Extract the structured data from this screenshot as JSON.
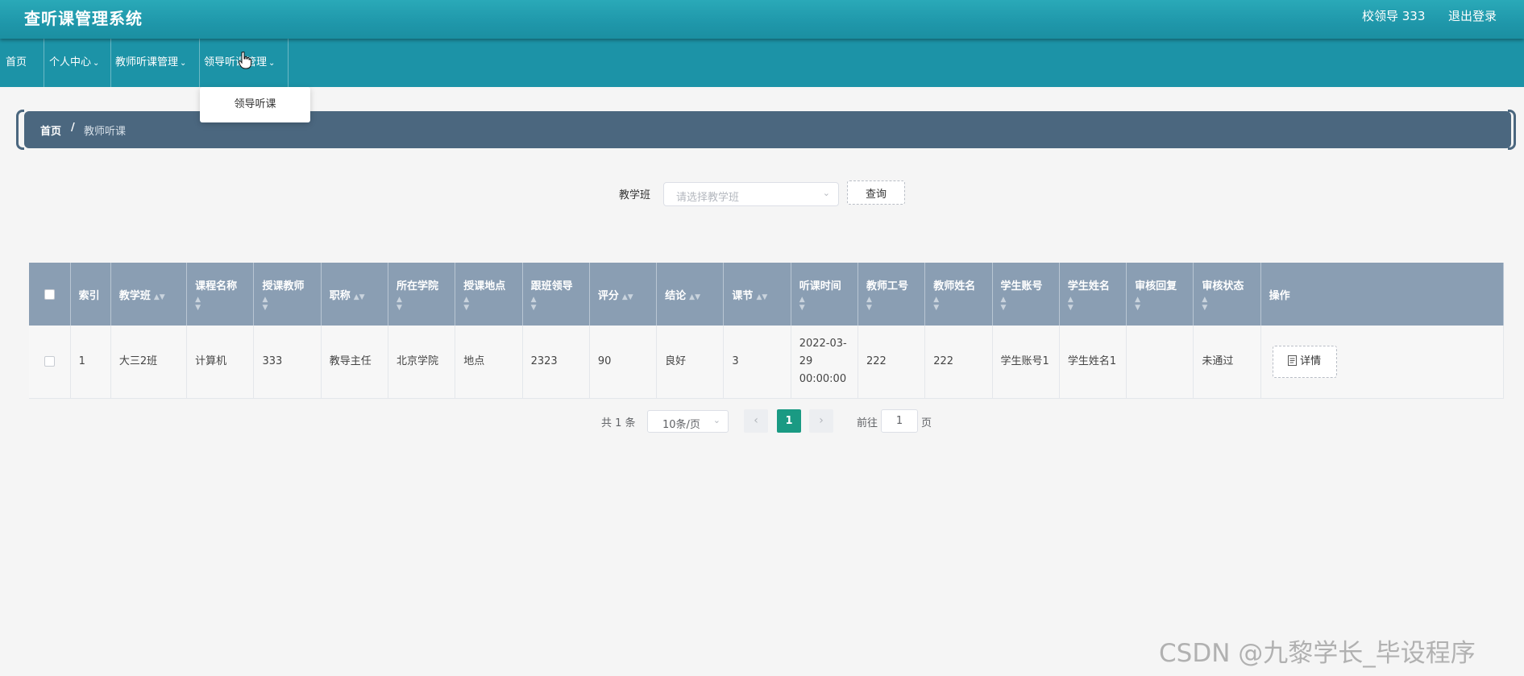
{
  "header": {
    "app_title": "查听课管理系统",
    "user_name": "校领导 333",
    "logout_label": "退出登录"
  },
  "nav": {
    "items": [
      {
        "label": "首页",
        "has_dropdown": false
      },
      {
        "label": "个人中心",
        "has_dropdown": true
      },
      {
        "label": "教师听课管理",
        "has_dropdown": true
      },
      {
        "label": "领导听课管理",
        "has_dropdown": true
      }
    ],
    "open_dropdown": {
      "items": [
        "领导听课"
      ]
    }
  },
  "breadcrumb": {
    "home": "首页",
    "separator": "/",
    "current": "教师听课"
  },
  "search": {
    "label": "教学班",
    "placeholder": "请选择教学班",
    "query_button": "查询"
  },
  "table": {
    "columns": [
      "索引",
      "教学班",
      "课程名称",
      "授课教师",
      "职称",
      "所在学院",
      "授课地点",
      "跟班领导",
      "评分",
      "结论",
      "课节",
      "听课时间",
      "教师工号",
      "教师姓名",
      "学生账号",
      "学生姓名",
      "审核回复",
      "审核状态",
      "操作"
    ],
    "rows": [
      [
        "1",
        "大三2班",
        "计算机",
        "333",
        "教导主任",
        "北京学院",
        "地点",
        "2323",
        "90",
        "良好",
        "3",
        "2022-03-29 00:00:00",
        "222",
        "222",
        "学生账号1",
        "学生姓名1",
        "",
        "未通过",
        ""
      ]
    ],
    "detail_button": "详情"
  },
  "pagination": {
    "total_text": "共 1 条",
    "page_size": "10条/页",
    "current_page": "1",
    "goto_label": "前往",
    "goto_value": "1",
    "goto_suffix": "页"
  },
  "watermark": "CSDN @九黎学长_毕设程序",
  "colors": {
    "header": "#1f97aa",
    "navbar": "#1c93a7",
    "breadcrumb": "#4b677f",
    "table_header": "#8a9eb3",
    "active_page": "#1a9a83"
  }
}
